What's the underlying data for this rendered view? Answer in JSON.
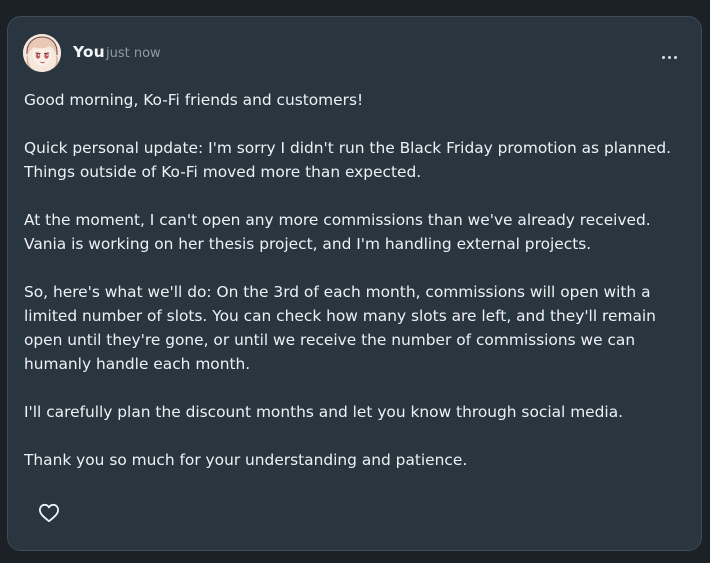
{
  "post": {
    "author": "You",
    "timestamp": "just now",
    "avatar_icon": "anime-avatar-icon",
    "menu_icon": "more-horizontal-icon",
    "like_icon": "heart-outline-icon",
    "paragraphs": [
      "Good morning, Ko-Fi friends and customers!",
      "Quick personal update: I'm sorry I didn't run the Black Friday promotion as planned. Things outside of Ko-Fi moved more than expected.",
      "At the moment, I can't open any more commissions than we've already received. Vania is working on her thesis project, and I'm handling external projects.",
      "So, here's what we'll do: On the 3rd of each month, commissions will open with a limited number of slots. You can check how many slots are left, and they'll remain open until they're gone, or until we receive the number of commissions we can humanly handle each month.",
      "I'll carefully plan the discount months and let you know through social media.",
      "Thank you so much for your understanding and patience."
    ]
  },
  "colors": {
    "page_background": "#1b2127",
    "card_background": "#293640",
    "card_border": "#3e4c57",
    "text": "#eef1f4",
    "muted_text": "#8f9aa4"
  }
}
